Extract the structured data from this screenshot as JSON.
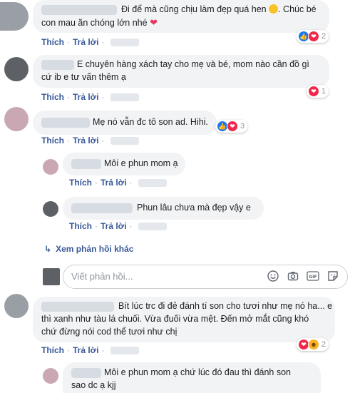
{
  "comments": [
    {
      "text_lines": [
        "Đi để mà cũng chịu làm đẹp quá hen",
        ". Chúc bé",
        "con mau ăn chóng lớn nhé"
      ],
      "reactions": {
        "icons": [
          "like-icon",
          "love-icon"
        ],
        "count": "2"
      }
    },
    {
      "text_lines": [
        "E chuyên hàng xách tay cho mẹ và bé, mom nào cần đồ gì",
        "cứ ib e tư vấn thêm ạ"
      ],
      "reactions": {
        "icons": [
          "love-icon"
        ],
        "count": "1"
      }
    },
    {
      "text_lines": [
        "Mẹ nó vẫn đc tô son ad. Hihi."
      ],
      "reactions": {
        "icons": [
          "like-icon",
          "love-icon"
        ],
        "count": "3"
      }
    },
    {
      "text_lines": [
        "Môi e phun mom ạ"
      ],
      "reactions": null
    },
    {
      "text_lines": [
        "Phun lâu chưa mà đẹp vậy e"
      ],
      "reactions": null
    },
    {
      "text_lines": [
        "Bít lúc trc đi đẻ đánh tí son cho tươi như mẹ nó ha... e",
        "thì xanh như tàu lá chuối. Vừa đuối vừa mệt. Đến mở mắt cũng khó",
        "chứ đừng nói cod thể tươi như chị"
      ],
      "reactions": {
        "icons": [
          "love-icon",
          "haha-icon"
        ],
        "count": "2"
      }
    },
    {
      "text_lines": [
        "Môi e phun mom ạ chứ lúc đó đau thì đánh son",
        "sao dc ạ kjj"
      ],
      "reactions": null
    }
  ],
  "actions": {
    "like": "Thích",
    "reply": "Trả lời",
    "sep": "·"
  },
  "see_more": "Xem phản hồi khác",
  "reply_box": {
    "placeholder": "Viết phản hồi..."
  },
  "colors": {
    "link": "#385898",
    "bubble": "#f2f3f5",
    "like": "#1877f2",
    "love": "#f0284a"
  }
}
